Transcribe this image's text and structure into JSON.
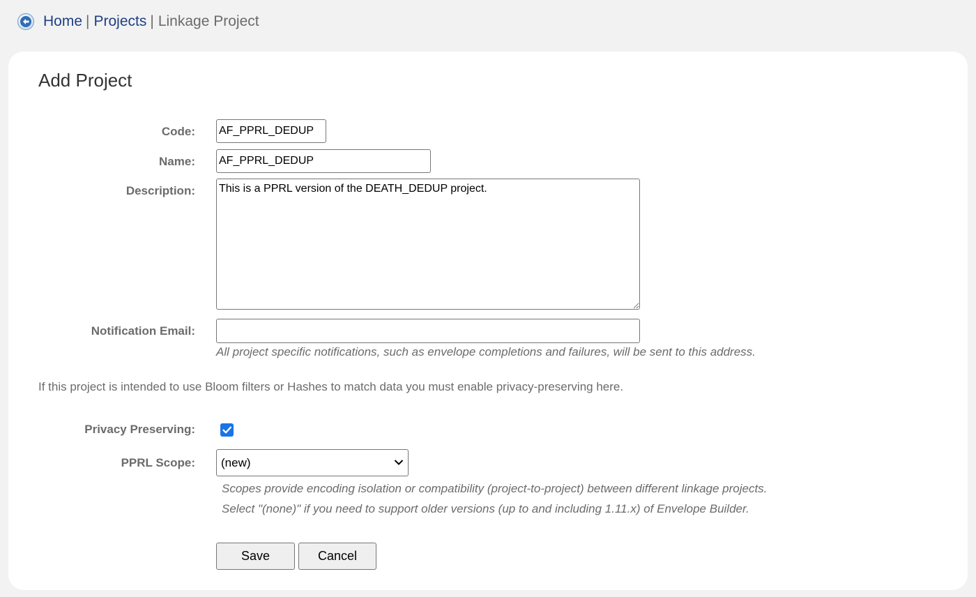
{
  "breadcrumb": {
    "back_icon": "arrow-left-circle-icon",
    "home": "Home",
    "sep1": "|",
    "projects": "Projects",
    "sep2": "|",
    "current": "Linkage Project"
  },
  "form": {
    "title": "Add Project",
    "code": {
      "label": "Code:",
      "value": "AF_PPRL_DEDUP"
    },
    "name": {
      "label": "Name:",
      "value": "AF_PPRL_DEDUP"
    },
    "description": {
      "label": "Description:",
      "value": "This is a PPRL version of the DEATH_DEDUP project."
    },
    "notification_email": {
      "label": "Notification Email:",
      "value": "",
      "hint": "All project specific notifications, such as envelope completions and failures, will be sent to this address."
    },
    "privacy_intro": "If this project is intended to use Bloom filters or Hashes to match data you must enable privacy-preserving here.",
    "privacy_preserving": {
      "label": "Privacy Preserving:",
      "checked": true
    },
    "pprl_scope": {
      "label": "PPRL Scope:",
      "selected": "(new)",
      "hint_line1": "Scopes provide encoding isolation or compatibility (project-to-project) between different linkage projects.",
      "hint_line2": "Select \"(none)\" if you need to support older versions (up to and including 1.11.x) of Envelope Builder."
    },
    "save_label": "Save",
    "cancel_label": "Cancel"
  },
  "colors": {
    "link": "#1f3f84",
    "muted_text": "#6b6b6b",
    "checkbox_accent": "#1a73e8",
    "page_background": "#f2f2f2",
    "card_background": "#ffffff"
  }
}
